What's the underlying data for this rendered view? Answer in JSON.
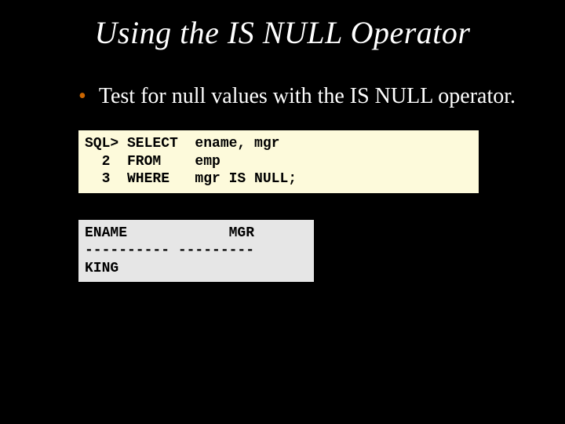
{
  "title": "Using the IS NULL Operator",
  "bullet": "Test for null values with the IS NULL operator.",
  "code": {
    "query": "SQL> SELECT  ename, mgr\n  2  FROM    emp\n  3  WHERE   mgr IS NULL;",
    "result": "ENAME            MGR\n---------- ---------\nKING"
  }
}
